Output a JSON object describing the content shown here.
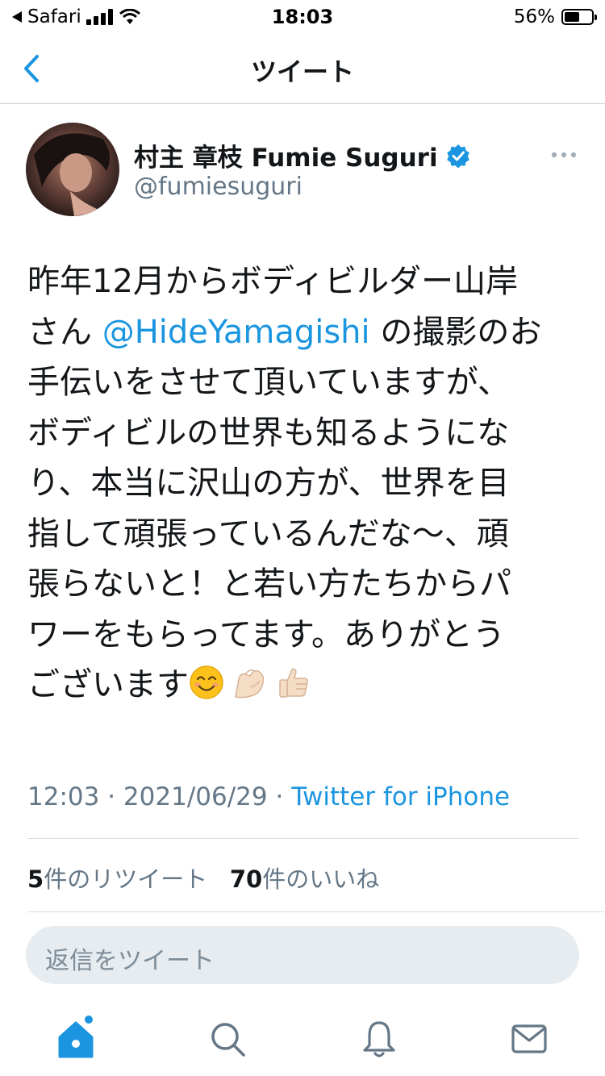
{
  "status_bar": {
    "carrier": "Safari",
    "time": "18:03",
    "battery_percent": "56%",
    "battery_level": 0.56
  },
  "nav": {
    "title": "ツイート"
  },
  "author": {
    "display_name": "村主 章枝 Fumie Suguri",
    "handle": "@fumiesuguri",
    "verified": true
  },
  "tweet": {
    "lines": [
      "昨年12月からボディビルダー山岸",
      "さん",
      "の撮影のお",
      "手伝いをさせて頂いていますが、",
      "ボディビルの世界も知るようにな",
      "り、本当に沢山の方が、世界を目",
      "指して頑張っているんだな〜、頑",
      "張らないと！と若い方たちからパ",
      "ワーをもらってます。ありがとう",
      "ございます"
    ],
    "mention": "@HideYamagishi",
    "emojis": [
      "smiling-face-emoji",
      "flexed-biceps-emoji",
      "thumbs-up-emoji"
    ]
  },
  "meta": {
    "time": "12:03",
    "date": "2021/06/29",
    "separator": "·",
    "source": "Twitter for iPhone"
  },
  "stats": {
    "retweet_count": "5",
    "retweet_label": "件のリツイート",
    "like_count": "70",
    "like_label": "件のいいね"
  },
  "reply": {
    "placeholder": "返信をツイート"
  },
  "tabbar": {
    "items": [
      "home-icon",
      "search-icon",
      "notifications-icon",
      "messages-icon"
    ]
  },
  "colors": {
    "accent": "#1b95e0",
    "secondary_text": "#657786",
    "reply_bg": "#e6ecf0"
  }
}
